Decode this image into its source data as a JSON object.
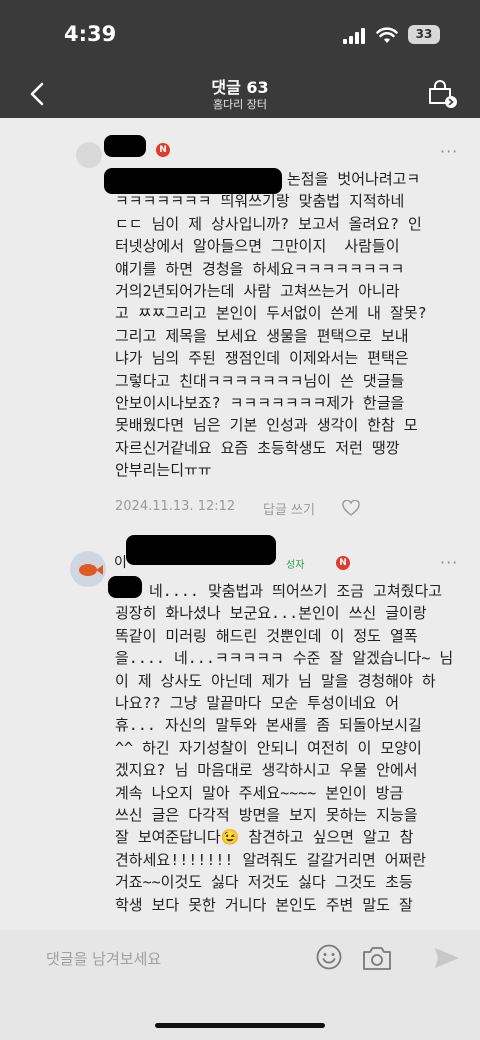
{
  "status": {
    "time": "4:39",
    "battery": "33"
  },
  "header": {
    "title": "댓글 63",
    "subtitle": "홈다리 장터"
  },
  "comments": [
    {
      "body": "논점을 벗어나려고ㅋ\nㅋㅋㅋㅋㅋㅋㅋ 띄워쓰기랑 맞춤법 지적하네\nㄷㄷ 님이 제 상사입니까? 보고서 올려요? 인\n터넷상에서 알아들으면 그만이지  사람들이\n얘기를 하면 경청을 하세요ㅋㅋㅋㅋㅋㅋㅋㅋ\n거의2년되어가는데 사람 고쳐쓰는거 아니라\n고 ㅉㅉ그리고 본인이 두서없이 쓴게 내 잘못?\n그리고 제목을 보세요 생물을 편택으로 보내\n냐가 님의 주된 쟁점인데 이제와서는 편택은\n그렇다고 친대ㅋㅋㅋㅋㅋㅋㅋ님이 쓴 댓글들\n안보이시나보죠? ㅋㅋㅋㅋㅋㅋㅋ제가 한글을\n못배웠다면 님은 기본 인성과 생각이 한참 모\n자르신거같네요 요즘 초등학생도 저런 땡깡\n안부리는디ㅠㅠ",
      "date": "2024.11.13. 12:12",
      "reply_label": "답글 쓰기"
    },
    {
      "name_visible": "이",
      "seller_label": "성자",
      "body": "네.... 맞춤법과 띄어쓰기 조금 고쳐줬다고\n굉장히 화나셨나 보군요...본인이 쓰신 글이랑\n똑같이 미러링 해드린 것뿐인데 이 정도 열폭\n을.... 네...ㅋㅋㅋㅋㅋ 수준 잘 알겠습니다~ 님\n이 제 상사도 아닌데 제가 님 말을 경청해야 하\n나요?? 그냥 말끝마다 모순 투성이네요 어\n휴... 자신의 말투와 본새를 좀 되돌아보시길\n^^ 하긴 자기성찰이 안되니 여전히 이 모양이\n겠지요? 님 마음대로 생각하시고 우물 안에서\n계속 나오지 말아 주세요~~~~ 본인이 방금\n쓰신 글은 다각적 방면을 보지 못하는 지능을\n잘 보여준답니다😉 참견하고 싶으면 알고 참\n견하세요!!!!!!! 알려줘도 갈갈거리면 어쩌란\n거죠~~이것도 싫다 저것도 싫다 그것도 초등\n학생 보다 못한 거니다 본인도 주변 말도 잘"
    }
  ],
  "input": {
    "placeholder": "댓글을 남겨보세요"
  }
}
